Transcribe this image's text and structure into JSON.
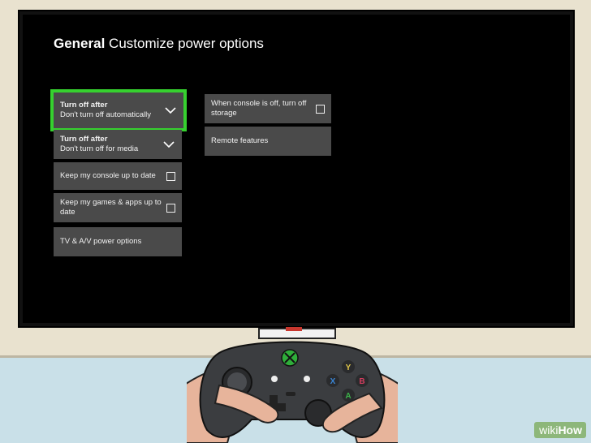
{
  "header": {
    "section": "General",
    "title": "Customize power options"
  },
  "left_column": [
    {
      "label": "Turn off after",
      "value": "Don't turn off automatically",
      "control": "dropdown",
      "focused": true
    },
    {
      "label": "Turn off after",
      "value": "Don't turn off for media",
      "control": "dropdown",
      "focused": false
    },
    {
      "label": "Keep my console up to date",
      "control": "checkbox",
      "checked": false
    },
    {
      "label": "Keep my games & apps up to date",
      "control": "checkbox",
      "checked": false
    },
    {
      "label": "TV & A/V power options",
      "control": "link"
    }
  ],
  "right_column": [
    {
      "label": "When console is off, turn off storage",
      "control": "checkbox",
      "checked": false
    },
    {
      "label": "Remote features",
      "control": "link"
    }
  ],
  "controller": {
    "buttons": [
      "Y",
      "B",
      "X",
      "A"
    ],
    "colors": {
      "Y": "#e0c64a",
      "B": "#d23d5e",
      "X": "#3a86d6",
      "A": "#3cb24a",
      "xbox": "#2fae3a"
    }
  },
  "watermark": {
    "prefix": "wiki",
    "suffix": "How"
  },
  "colors": {
    "focus": "#36d12f",
    "tile": "#4a4a4a",
    "screen": "#000000"
  }
}
